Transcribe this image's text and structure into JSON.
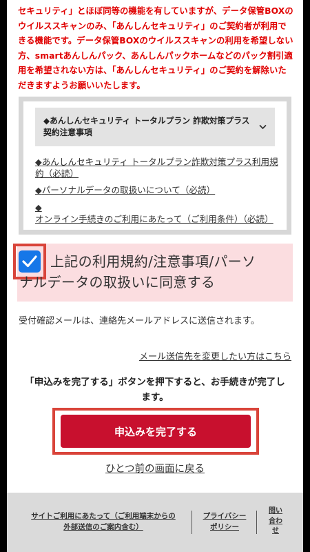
{
  "warning_text": "セキュリティ」とほぼ同等の機能を有していますが、データ保管BOXのウイルススキャンのみ、「あんしんセキュリティ」のご契約者が利用できる機能です。データ保管BOXのウイルススキャンの利用を希望しない方、smartあんしんパック、あんしんパックホームなどのパック割引適用を希望されない方は、「あんしんセキュリティ」のご契約を解除いただきますようお願いいたします。",
  "terms": {
    "header": "◆あんしんセキュリティ トータルプラン 詐欺対策プラス契約注意事項",
    "links": [
      {
        "mark": "◆",
        "text": "あんしんセキュリティ トータルプラン詐欺対策プラス利用規約（必読）"
      },
      {
        "mark": "◆",
        "text": "パーソナルデータの取扱いについて（必読）"
      },
      {
        "mark": "◆",
        "text": "オンライン手続きのご利用にあたって（ご利用条件）（必読）"
      }
    ]
  },
  "consent": {
    "checked": true,
    "line1": "上記の利用規約/注意事項/パーソ",
    "line2": "ナルデータの取扱いに同意する"
  },
  "note": "受付確認メールは、連絡先メールアドレスに送信されます。",
  "change_link": "メール送信先を変更したい方はこちら",
  "instruction": "「申込みを完了する」ボタンを押下すると、お手続きが完了します。",
  "submit_label": "申込みを完了する",
  "back_label": "ひとつ前の画面に戻る",
  "footer": {
    "site_usage_line1": "サイトご利用にあたって（ご利用端末からの",
    "site_usage_line2": "外部送信のご案内含む）",
    "privacy_line1": "プライバシー",
    "privacy_line2": "ポリシー",
    "contact_line1": "問い",
    "contact_line2": "合わ",
    "contact_line3": "せ"
  },
  "colors": {
    "warning": "#e00000",
    "accent": "#c8102e",
    "checkbox": "#1677e8",
    "consent_bg": "#fbdde0",
    "highlight_frame": "#d9443a"
  },
  "icons": [
    "chevron-down-icon",
    "checkmark-icon"
  ]
}
